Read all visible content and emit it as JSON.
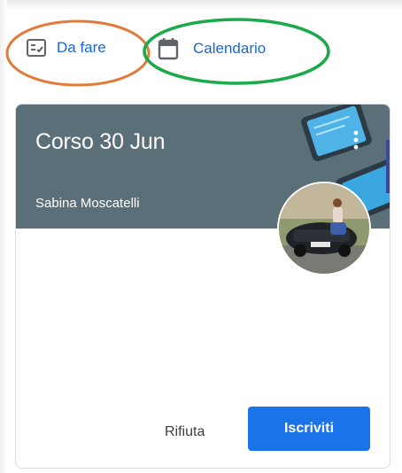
{
  "nav": {
    "todo_label": "Da fare",
    "calendar_label": "Calendario"
  },
  "class_card": {
    "title": "Corso 30 Jun",
    "teacher": "Sabina Moscatelli",
    "decline_label": "Rifiuta",
    "join_label": "Iscriviti"
  },
  "annotations": {
    "todo_circle_color": "#e07b39",
    "calendar_circle_color": "#1aaa4b"
  },
  "colors": {
    "accent": "#1a73e8",
    "link": "#1967d2",
    "header": "#5b6f78"
  }
}
